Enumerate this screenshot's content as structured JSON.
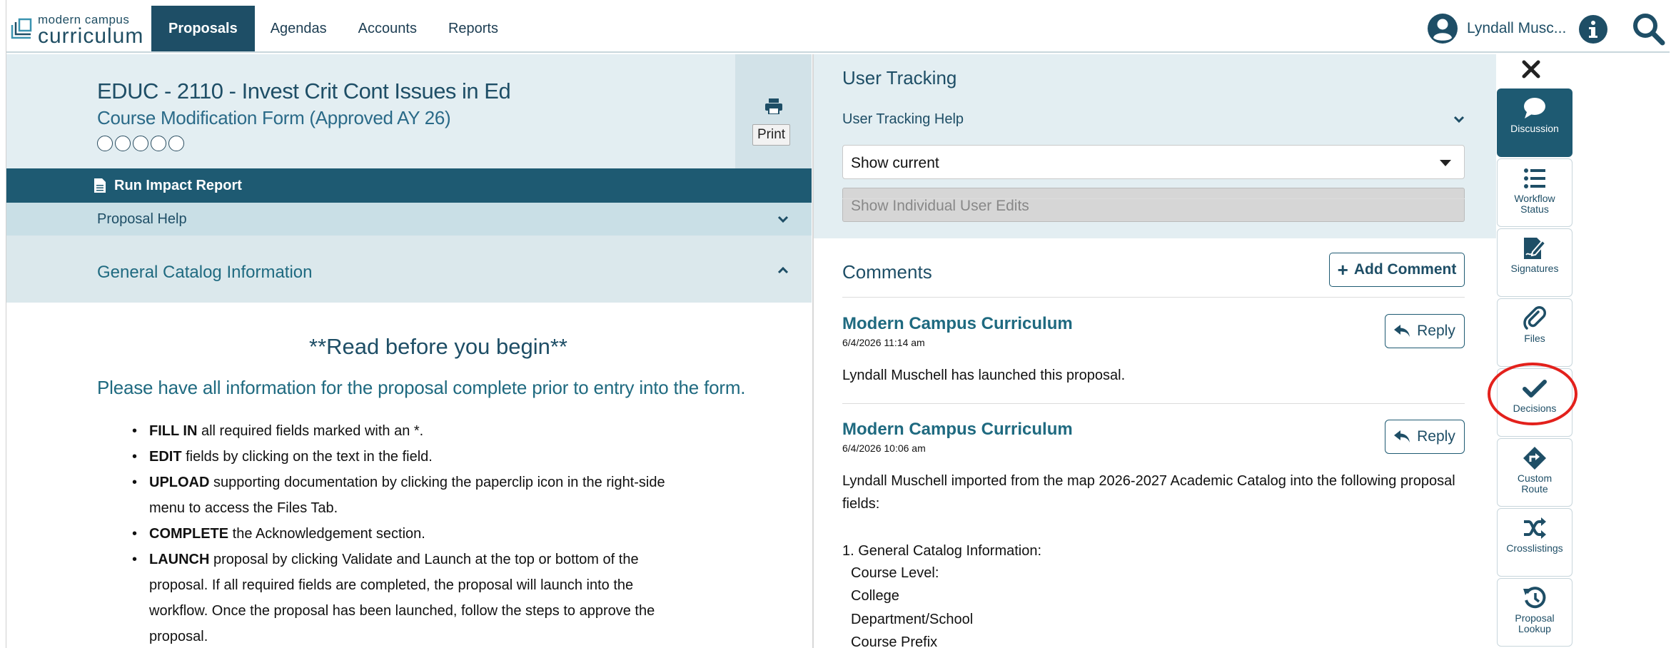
{
  "app": {
    "logo_small": "modern campus",
    "logo_big": "curriculum"
  },
  "nav": {
    "tabs": [
      {
        "label": "Proposals",
        "active": true
      },
      {
        "label": "Agendas",
        "active": false
      },
      {
        "label": "Accounts",
        "active": false
      },
      {
        "label": "Reports",
        "active": false
      }
    ],
    "user_name": "Lyndall Musc...",
    "info_icon": "info-icon",
    "search_icon": "search-icon"
  },
  "proposal": {
    "title": "EDUC - 2110 - Invest Crit Cont Issues in Ed",
    "subtitle": "Course Modification Form (Approved AY 26)",
    "print_tooltip": "Print",
    "run_impact_report": "Run Impact Report",
    "proposal_help": "Proposal Help",
    "section_title": "General Catalog Information",
    "read_before": "**Read before you begin**",
    "please_note": "Please have all information for the proposal complete prior to entry into the form.",
    "bullets": [
      {
        "bold": "FILL IN",
        "text": " all required fields marked with an *."
      },
      {
        "bold": "EDIT",
        "text": " fields by clicking on the text in the field."
      },
      {
        "bold": "UPLOAD",
        "text": " supporting documentation by clicking the paperclip icon in the right-side menu to access the Files Tab."
      },
      {
        "bold": "COMPLETE",
        "text": " the Acknowledgement section."
      },
      {
        "bold": "LAUNCH",
        "text": " proposal by clicking Validate and Launch at the top or bottom of the proposal.  If all required fields are completed, the proposal will launch into the workflow. Once the proposal has been launched, follow the steps to approve the proposal."
      }
    ]
  },
  "user_tracking": {
    "title": "User Tracking",
    "help": "User Tracking Help",
    "select_value": "Show current",
    "individual_edits": "Show Individual User Edits"
  },
  "comments": {
    "title": "Comments",
    "add_label": "Add Comment",
    "reply_label": "Reply",
    "items": [
      {
        "author": "Modern Campus Curriculum",
        "date": "6/4/2026 11:14 am",
        "text": "Lyndall Muschell has launched this proposal."
      },
      {
        "author": "Modern Campus Curriculum",
        "date": "6/4/2026 10:06 am",
        "text": "Lyndall Muschell imported from the map 2026-2027 Academic Catalog into the following proposal fields:",
        "list": [
          "1. General Catalog Information:",
          "Course Level:",
          "College",
          "Department/School",
          "Course Prefix"
        ]
      }
    ]
  },
  "sidebar": {
    "items": [
      {
        "label": "Discussion",
        "icon": "discussion-icon",
        "active": true
      },
      {
        "label": "Workflow Status",
        "icon": "workflow-list-icon",
        "active": false
      },
      {
        "label": "Signatures",
        "icon": "signature-icon",
        "active": false
      },
      {
        "label": "Files",
        "icon": "paperclip-icon",
        "active": false
      },
      {
        "label": "Decisions",
        "icon": "checkmark-icon",
        "active": false
      },
      {
        "label": "Custom Route",
        "icon": "route-sign-icon",
        "active": false
      },
      {
        "label": "Crosslistings",
        "icon": "shuffle-icon",
        "active": false
      },
      {
        "label": "Proposal Lookup",
        "icon": "history-icon",
        "active": false
      }
    ]
  },
  "colors": {
    "brand_dark": "#1e4e66",
    "brand_teal": "#1f6a80",
    "panel_light": "#e3eef2",
    "highlight_circle": "#e3211c"
  }
}
